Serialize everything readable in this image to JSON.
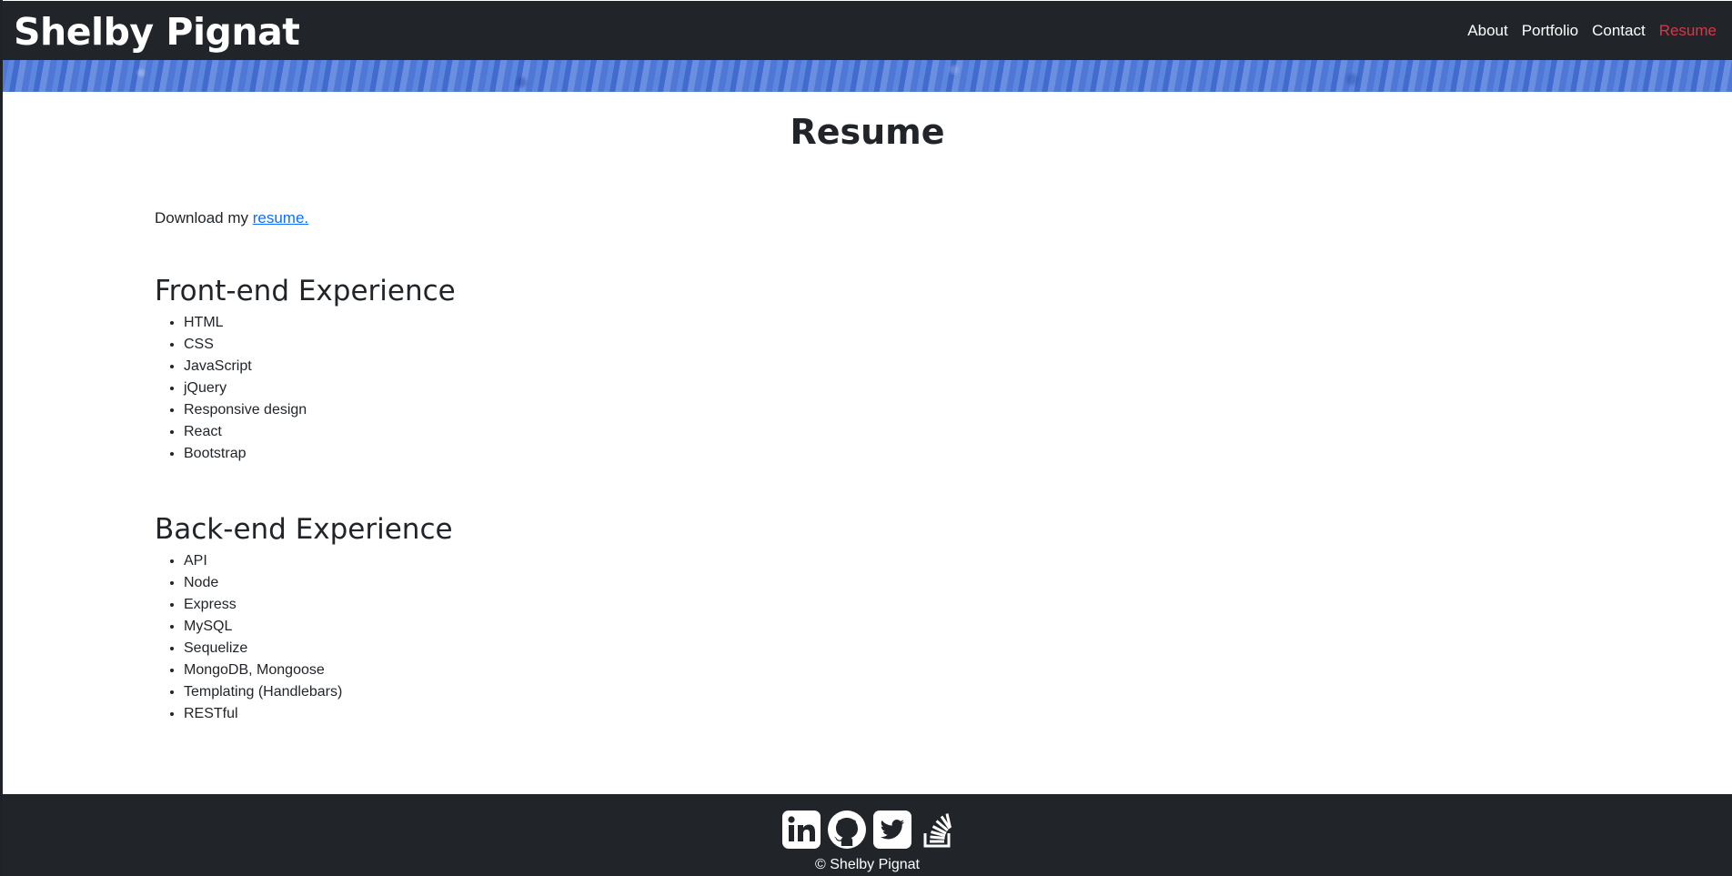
{
  "header": {
    "brand": "Shelby Pignat",
    "nav": [
      {
        "label": "About",
        "active": false
      },
      {
        "label": "Portfolio",
        "active": false
      },
      {
        "label": "Contact",
        "active": false
      },
      {
        "label": "Resume",
        "active": true
      }
    ]
  },
  "main": {
    "title": "Resume",
    "download_prefix": "Download my ",
    "download_link": "resume.",
    "frontend": {
      "title": "Front-end Experience",
      "items": [
        "HTML",
        "CSS",
        "JavaScript",
        "jQuery",
        "Responsive design",
        "React",
        "Bootstrap"
      ]
    },
    "backend": {
      "title": "Back-end Experience",
      "items": [
        "API",
        "Node",
        "Express",
        "MySQL",
        "Sequelize",
        "MongoDB, Mongoose",
        "Templating (Handlebars)",
        "RESTful"
      ]
    }
  },
  "footer": {
    "social_icons": [
      "linkedin-icon",
      "github-icon",
      "twitter-icon",
      "stackoverflow-icon"
    ],
    "copyright": "© Shelby Pignat"
  },
  "colors": {
    "navbar_bg": "#212529",
    "active_link": "#dc3545",
    "link": "#0d6efd",
    "banner": "#4f78d6"
  }
}
